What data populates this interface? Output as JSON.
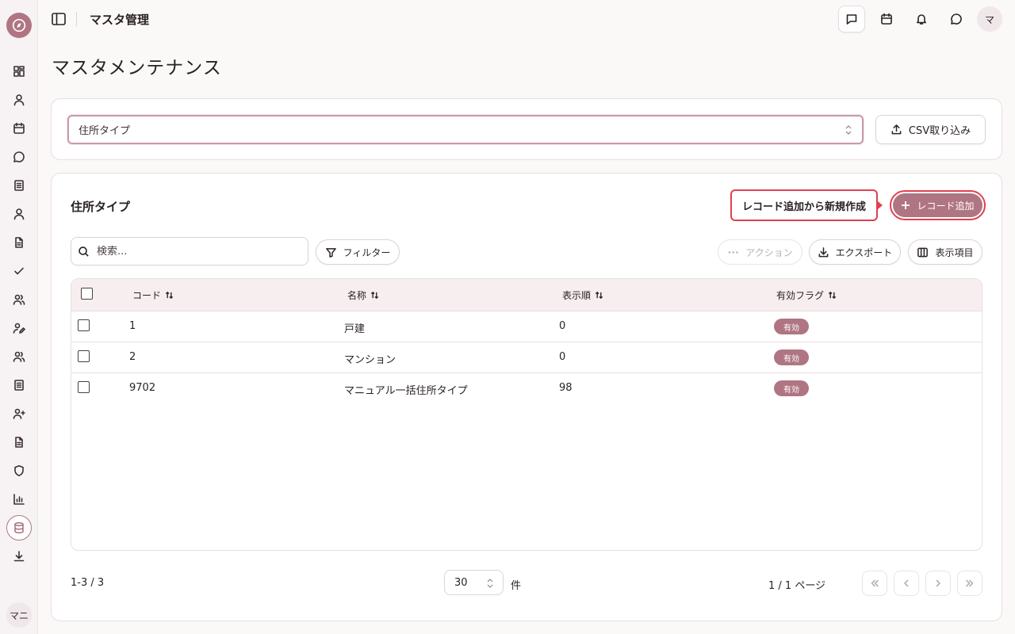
{
  "app": {
    "user_initial": "マ",
    "sidebar_user": "マニ"
  },
  "header": {
    "title": "マスタ管理"
  },
  "page": {
    "title": "マスタメンテナンス"
  },
  "master_select": {
    "value": "住所タイプ"
  },
  "csv_button": {
    "label": "CSV取り込み"
  },
  "table_card": {
    "title": "住所タイプ",
    "tooltip": "レコード追加から新規作成",
    "add_button": "レコード追加",
    "search_placeholder": "検索...",
    "filter_button": "フィルター",
    "action_button": "アクション",
    "export_button": "エクスポート",
    "columns_button": "表示項目"
  },
  "table": {
    "headers": [
      "コード",
      "名称",
      "表示順",
      "有効フラグ"
    ],
    "rows": [
      {
        "code": "1",
        "name": "戸建",
        "order": "0",
        "flag": "有効"
      },
      {
        "code": "2",
        "name": "マンション",
        "order": "0",
        "flag": "有効"
      },
      {
        "code": "9702",
        "name": "マニュアル一括住所タイプ",
        "order": "98",
        "flag": "有効"
      }
    ]
  },
  "pagination": {
    "count": "1-3 / 3",
    "page_size": "30",
    "unit": "件",
    "page_info": "1 / 1 ページ"
  },
  "colors": {
    "accent": "#b07582",
    "highlight": "#e04050"
  },
  "sidebar_icons": [
    "dashboard-icon",
    "user-icon",
    "calendar-icon",
    "chat-icon",
    "document-icon",
    "user-icon",
    "file-icon",
    "check-icon",
    "users-icon",
    "user-edit-icon",
    "users-icon",
    "document-icon",
    "user-add-icon",
    "file-icon",
    "shield-icon",
    "chart-icon",
    "database-icon",
    "download-icon"
  ]
}
